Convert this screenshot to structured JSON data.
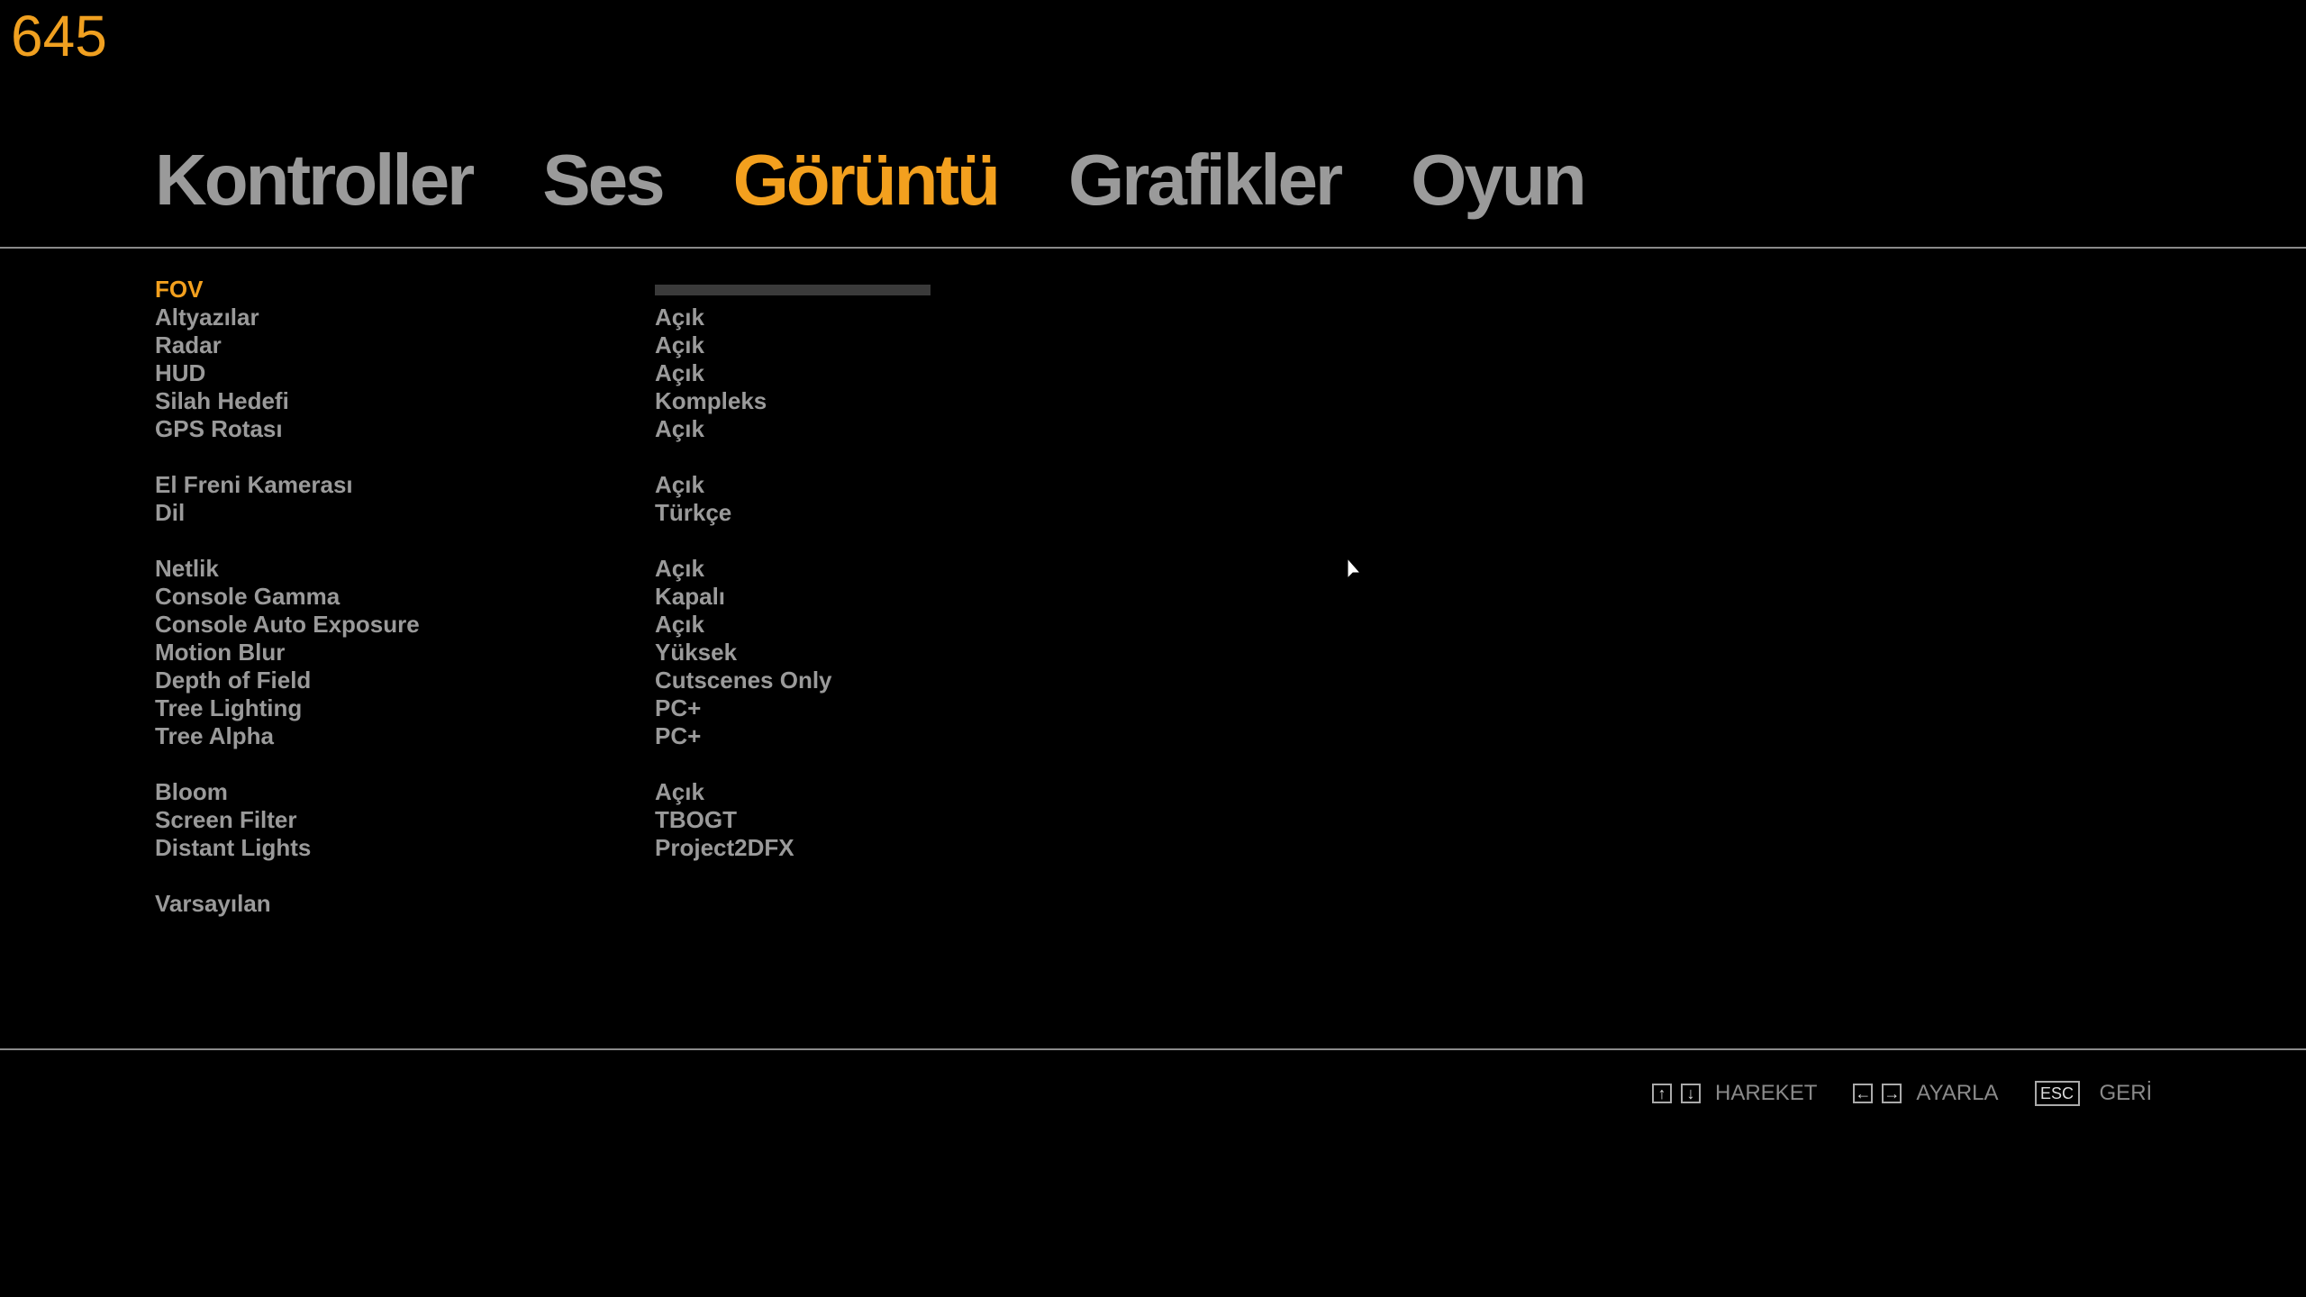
{
  "fps": "645",
  "tabs": [
    {
      "label": "Kontroller",
      "active": false
    },
    {
      "label": "Ses",
      "active": false
    },
    {
      "label": "Görüntü",
      "active": true
    },
    {
      "label": "Grafikler",
      "active": false
    },
    {
      "label": "Oyun",
      "active": false
    }
  ],
  "settings": {
    "fov": {
      "label": "FOV",
      "level": 0.0
    },
    "subtitles": {
      "label": "Altyazılar",
      "value": "Açık"
    },
    "radar": {
      "label": "Radar",
      "value": "Açık"
    },
    "hud": {
      "label": "HUD",
      "value": "Açık"
    },
    "weapon_target": {
      "label": "Silah Hedefi",
      "value": "Kompleks"
    },
    "gps_route": {
      "label": "GPS Rotası",
      "value": "Açık"
    },
    "handbrake_camera": {
      "label": "El Freni Kamerası",
      "value": "Açık"
    },
    "language": {
      "label": "Dil",
      "value": "Türkçe"
    },
    "sharpness": {
      "label": "Netlik",
      "value": "Açık"
    },
    "console_gamma": {
      "label": "Console Gamma",
      "value": "Kapalı"
    },
    "console_auto_exposure": {
      "label": "Console Auto Exposure",
      "value": "Açık"
    },
    "motion_blur": {
      "label": "Motion Blur",
      "value": "Yüksek"
    },
    "depth_of_field": {
      "label": "Depth of Field",
      "value": "Cutscenes Only"
    },
    "tree_lighting": {
      "label": "Tree Lighting",
      "value": "PC+"
    },
    "tree_alpha": {
      "label": "Tree Alpha",
      "value": "PC+"
    },
    "bloom": {
      "label": "Bloom",
      "value": "Açık"
    },
    "screen_filter": {
      "label": "Screen Filter",
      "value": "TBOGT"
    },
    "distant_lights": {
      "label": "Distant Lights",
      "value": "Project2DFX"
    },
    "defaults": {
      "label": "Varsayılan"
    }
  },
  "footer": {
    "move_label": "HAREKET",
    "adjust_label": "AYARLA",
    "back_key": "ESC",
    "back_label": "GERİ"
  },
  "colors": {
    "accent": "#f3a01e",
    "text": "#9a9a9a",
    "background": "#000000"
  }
}
